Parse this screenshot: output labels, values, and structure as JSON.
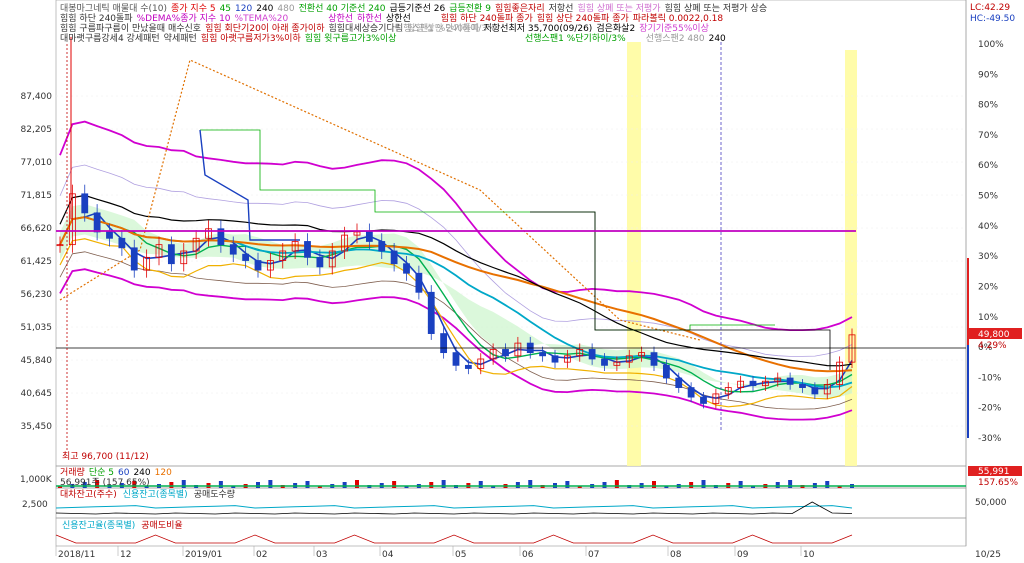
{
  "colors": {
    "candle_up": "#e00000",
    "candle_down": "#1a40c0",
    "ma5": "#1a40c0",
    "ma20": "#00b050",
    "ma60": "#00a8c8",
    "ma120": "#e87000",
    "ma240": "#000000",
    "envelope": "#d000d0",
    "flat": "#c000c0",
    "price_line": "#000000",
    "cloud": "#ccf5cc",
    "highlight": "#fffca0"
  },
  "legend": {
    "row1": [
      "대봉마그네틱 매물대 수(10)",
      "종가 지수 5",
      "45",
      "120",
      "240",
      "480",
      "전환선 40 기준선 240",
      "급등기준선 26",
      "급등전환 9",
      "힘힘좋은자리",
      "저항선",
      "힘힘 상폐 또는 저평가",
      "힘힘 상폐 또는 저평가 상승"
    ],
    "row2": [
      "힘힘 하단 240돌파",
      "%DEMA%종가 지수 10",
      "%TEMA%20",
      "상한선",
      "하한선",
      "상한선",
      "힘힘 하단 240돌파 종가",
      "힘힘 상단 240돌파 종가",
      "파라볼릭 0.0022,0.18"
    ],
    "row3": [
      "힘힘 구름파구름이 만났을때 매수신호",
      "힘힘 회단기20이 아래 종가이하",
      "힘힘대세상승기다림",
      "힘힘 상단 240돌파",
      "저항선최저 35,700(09/26)",
      "검은화살2",
      "장기기준55%이상"
    ],
    "row4": [
      "대마랫구름강세4 강세패턴",
      "약세패턴",
      "힘힘 아랫구름저가3%이하",
      "힘힘 윗구름고가3%이상",
      "선행스팬1 %단기하이/3%",
      "선행스팬1 %단기하이/3%",
      "선행스팬2 480",
      "240"
    ],
    "lc": "LC:42.29",
    "hc": "HC:-49.50"
  },
  "annotation": {
    "max": "최고 96,700 (11/12)"
  },
  "price_badge": "49,800",
  "pct_badge": "4.29%",
  "volume": {
    "label": "거래량",
    "items": [
      "단순 5",
      "60",
      "240",
      "120"
    ],
    "sub": "56,991주 (157.65%)",
    "axis": "1,000K",
    "badge": "55,991",
    "badge2": "157.65%"
  },
  "short": {
    "items": [
      "대차잔고(주수)",
      "신용잔고(종목별)",
      "공매도수량"
    ],
    "axis": "2,500",
    "right_axis": "50,000"
  },
  "credit": {
    "items": [
      "신용잔고율(종목별)",
      "공매도비율"
    ]
  },
  "chart_data": {
    "type": "candlestick",
    "y_ticks": [
      "87,400",
      "82,205",
      "77,010",
      "71,815",
      "66,620",
      "61,425",
      "56,230",
      "51,035",
      "45,840",
      "40,645",
      "35,450"
    ],
    "y_values": [
      87400,
      82205,
      77010,
      71815,
      66620,
      61425,
      56230,
      51035,
      45840,
      40645,
      35450
    ],
    "pct_ticks": [
      "100%",
      "90%",
      "80%",
      "70%",
      "60%",
      "50%",
      "40%",
      "30%",
      "20%",
      "10%",
      "0%",
      "-10%",
      "-20%",
      "-30%"
    ],
    "x_labels": [
      "2018/11",
      "12",
      "2019/01",
      "02",
      "03",
      "04",
      "05",
      "06",
      "07",
      "08",
      "09",
      "10",
      "10/25"
    ],
    "current_price": 49800,
    "max_price": 96700,
    "resistance_low": 35700,
    "highlight_line": 66620,
    "close": [
      64000,
      72000,
      69000,
      66000,
      65000,
      63500,
      60000,
      62000,
      64000,
      61000,
      63000,
      65000,
      66500,
      64000,
      62500,
      61500,
      60000,
      61500,
      63000,
      64500,
      62000,
      60500,
      63000,
      65500,
      66000,
      64500,
      63000,
      61000,
      59500,
      56500,
      50000,
      47000,
      45000,
      44500,
      46000,
      47500,
      46500,
      48500,
      47000,
      46500,
      45500,
      46500,
      47500,
      46000,
      45000,
      45500,
      46500,
      47000,
      45000,
      43000,
      41500,
      40000,
      39000,
      40500,
      41500,
      42500,
      41800,
      42500,
      43000,
      42000,
      41500,
      40500,
      42000,
      45500,
      49800
    ]
  }
}
